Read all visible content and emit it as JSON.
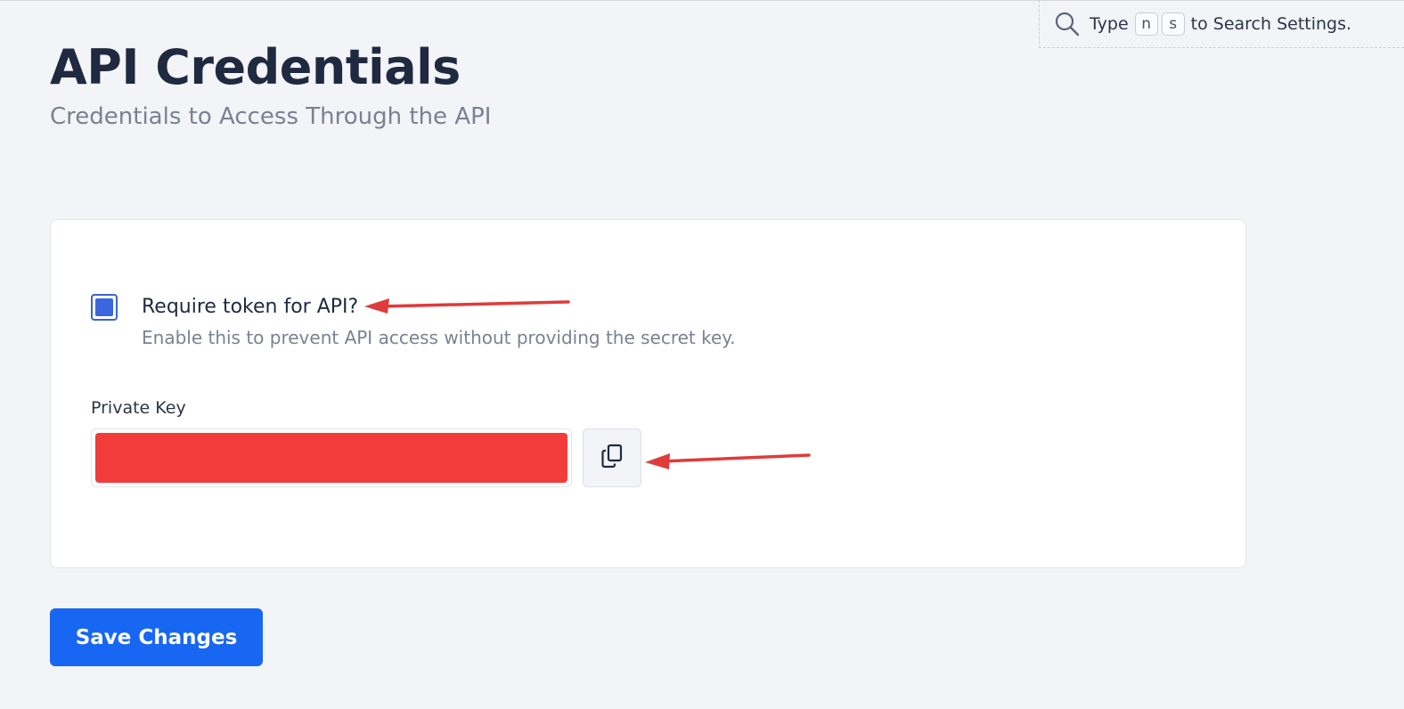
{
  "search_hint": {
    "prefix": "Type",
    "key1": "n",
    "key2": "s",
    "suffix": "to Search Settings."
  },
  "page": {
    "title": "API Credentials",
    "subtitle": "Credentials to Access Through the API"
  },
  "require_token": {
    "checked": true,
    "label": "Require token for API?",
    "description": "Enable this to prevent API access without providing the secret key."
  },
  "private_key": {
    "label": "Private Key",
    "value": ""
  },
  "save_button": {
    "label": "Save Changes"
  },
  "colors": {
    "accent": "#1867f2",
    "checkbox": "#3b66e0",
    "redaction": "#f23c3c",
    "annotation_arrow": "#e03a3a"
  }
}
